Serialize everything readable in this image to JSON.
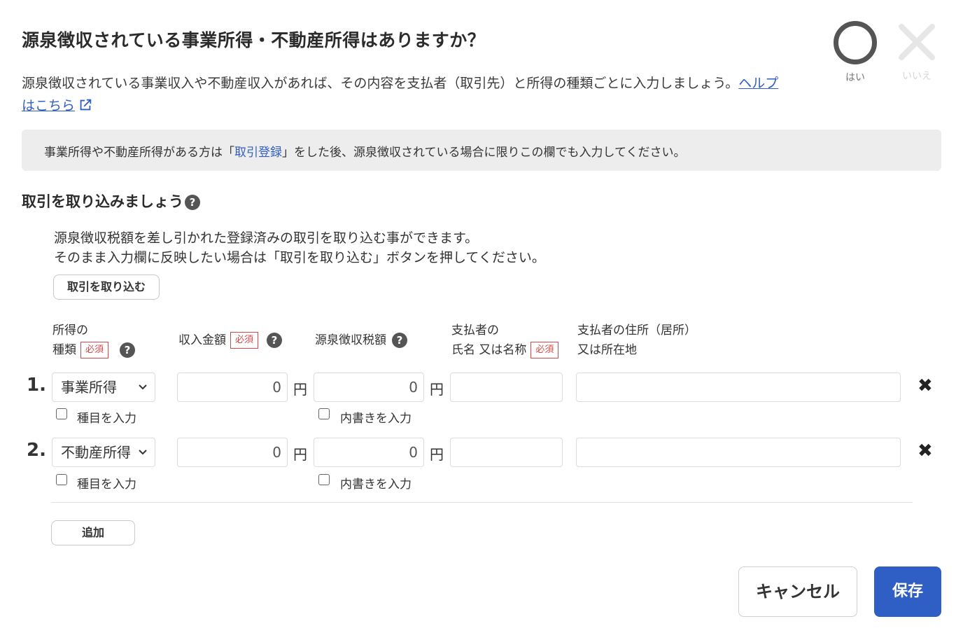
{
  "header": {
    "title": "源泉徴収されている事業所得・不動産所得はありますか？",
    "description": "源泉徴収されている事業収入や不動産収入があれば、その内容を支払者（取引先）と所得の種類ごとに入力しましょう。",
    "help_link": "ヘルプはこちら"
  },
  "answer": {
    "yes_label": "はい",
    "no_label": "いいえ",
    "selected": "yes"
  },
  "notice": {
    "before": "事業所得や不動産所得がある方は「",
    "link": "取引登録",
    "after": "」をした後、源泉徴収されている場合に限りこの欄でも入力してください。"
  },
  "import_section": {
    "title": "取引を取り込みましょう",
    "desc_line1": "源泉徴収税額を差し引かれた登録済みの取引を取り込む事ができます。",
    "desc_line2": "そのまま入力欄に反映したい場合は「取引を取り込む」ボタンを押してください。",
    "button": "取引を取り込む"
  },
  "table": {
    "headers": {
      "type_line1": "所得の",
      "type_line2": "種類",
      "income": "収入金額",
      "tax": "源泉徴収税額",
      "payer_line1": "支払者の",
      "payer_line2": "氏名 又は名称",
      "address_line1": "支払者の住所（居所）",
      "address_line2": "又は所在地",
      "required": "必須"
    },
    "currency": "円",
    "rows": [
      {
        "num": "1.",
        "type": "事業所得",
        "income": "0",
        "tax": "0",
        "payer": "",
        "address": "",
        "item_checkbox": "種目を入力",
        "detail_checkbox": "内書きを入力"
      },
      {
        "num": "2.",
        "type": "不動産所得",
        "income": "0",
        "tax": "0",
        "payer": "",
        "address": "",
        "item_checkbox": "種目を入力",
        "detail_checkbox": "内書きを入力"
      }
    ],
    "add_button": "追加"
  },
  "footer": {
    "cancel": "キャンセル",
    "save": "保存"
  },
  "colors": {
    "primary": "#2f5fc4",
    "required": "#d04a4a",
    "notice_bg": "#ededed"
  }
}
